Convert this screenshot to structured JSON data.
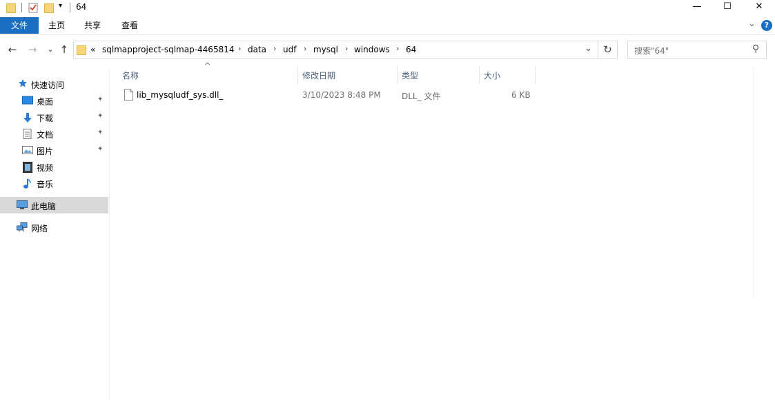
{
  "window": {
    "title": "64",
    "minimize_glyph": "—",
    "maximize_glyph": "☐",
    "close_glyph": "✕"
  },
  "ribbon": {
    "tabs": [
      {
        "label": "文件"
      },
      {
        "label": "主页"
      },
      {
        "label": "共享"
      },
      {
        "label": "查看"
      }
    ],
    "expand_glyph": "⌄",
    "help_glyph": "?"
  },
  "address": {
    "overflow": "«",
    "crumbs": [
      "sqlmapproject-sqlmap-4465814",
      "data",
      "udf",
      "mysql",
      "windows",
      "64"
    ],
    "separator": "›",
    "dropdown_glyph": "⌄",
    "refresh_glyph": "↻"
  },
  "nav_buttons": {
    "back": "←",
    "forward": "→",
    "recent": "⌄",
    "up": "↑"
  },
  "search": {
    "placeholder": "搜索\"64\"",
    "icon_glyph": "⚲"
  },
  "sidebar": {
    "quick_access": "快速访问",
    "items": [
      {
        "label": "桌面",
        "icon": "desktop-icon",
        "pinned": true
      },
      {
        "label": "下载",
        "icon": "download-icon",
        "pinned": true
      },
      {
        "label": "文档",
        "icon": "document-icon",
        "pinned": true
      },
      {
        "label": "图片",
        "icon": "pictures-icon",
        "pinned": true
      },
      {
        "label": "视频",
        "icon": "video-icon",
        "pinned": false
      },
      {
        "label": "音乐",
        "icon": "music-icon",
        "pinned": false
      }
    ],
    "this_pc": "此电脑",
    "network": "网络",
    "pin_glyph": "📌"
  },
  "columns": {
    "sort_glyph": "^",
    "name": "名称",
    "date": "修改日期",
    "type": "类型",
    "size": "大小"
  },
  "files": [
    {
      "name": "lib_mysqludf_sys.dll_",
      "modified": "3/10/2023 8:48 PM",
      "type": "DLL_ 文件",
      "size": "6 KB"
    }
  ],
  "colors": {
    "accent": "#1a6fc2",
    "selected_nav": "#d9d9d9",
    "folder": "#f6d676"
  }
}
